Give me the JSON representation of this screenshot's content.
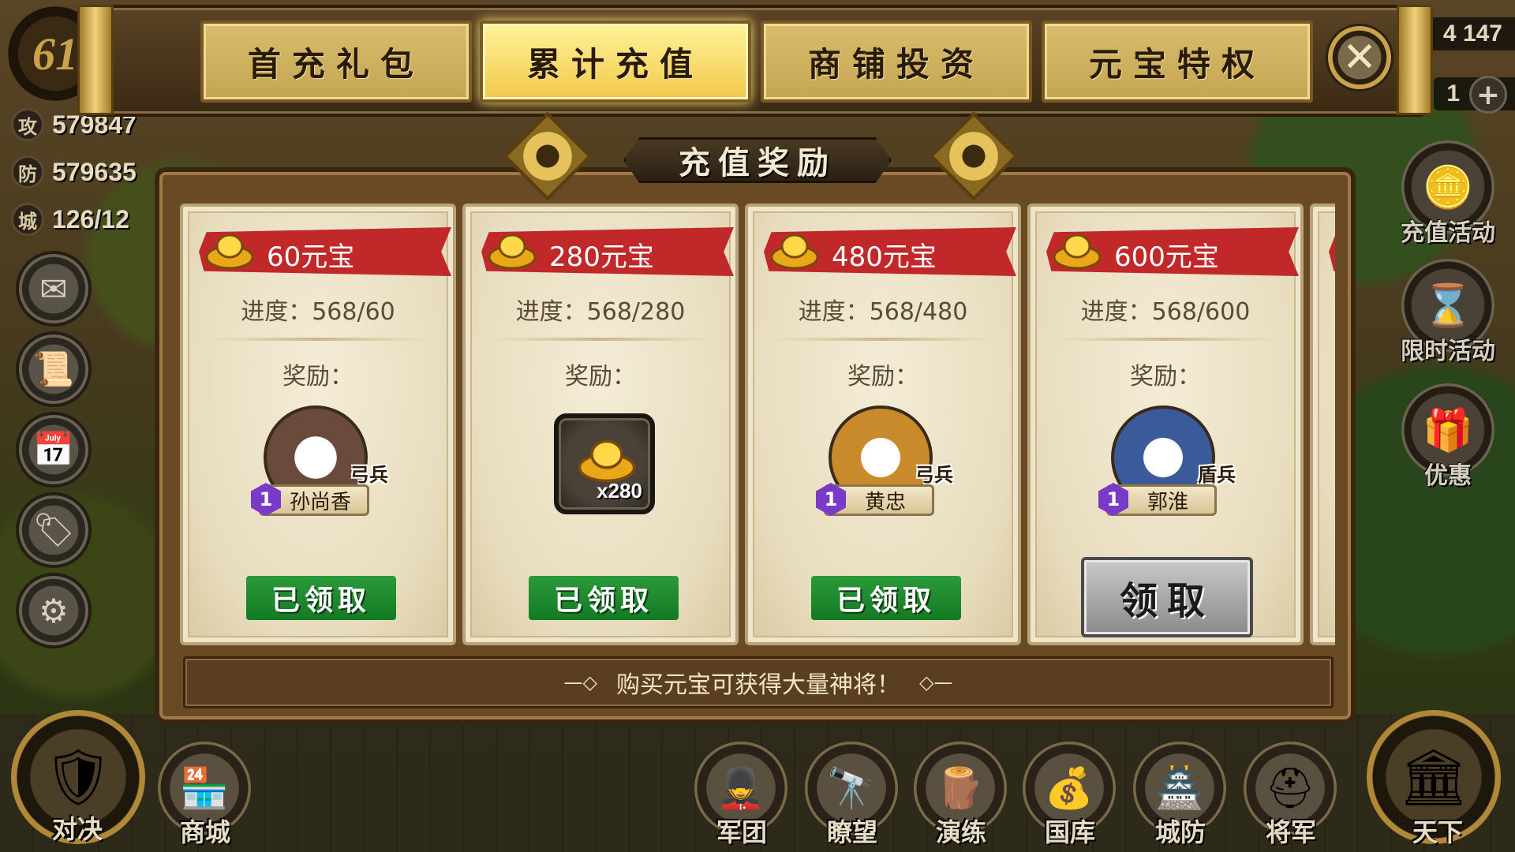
{
  "hud": {
    "level": "61",
    "stats": [
      {
        "icon": "攻",
        "value": "579847"
      },
      {
        "icon": "防",
        "value": "579635"
      },
      {
        "icon": "城",
        "value": "126/12"
      }
    ],
    "resources": [
      "4 147",
      "1"
    ]
  },
  "tabs": [
    {
      "label": "首充礼包",
      "active": false
    },
    {
      "label": "累计充值",
      "active": true
    },
    {
      "label": "商铺投资",
      "active": false
    },
    {
      "label": "元宝特权",
      "active": false
    }
  ],
  "panel": {
    "title": "充值奖励",
    "footer": "购买元宝可获得大量神将！"
  },
  "cards": [
    {
      "title": "60元宝",
      "progress": "进度：568/60",
      "reward_label": "奖励：",
      "reward": {
        "kind": "hero",
        "name": "孙尚香",
        "class": "弓兵",
        "star": "1"
      },
      "button": "已领取",
      "claimed": true
    },
    {
      "title": "280元宝",
      "progress": "进度：568/280",
      "reward_label": "奖励：",
      "reward": {
        "kind": "item",
        "count": "x280"
      },
      "button": "已领取",
      "claimed": true
    },
    {
      "title": "480元宝",
      "progress": "进度：568/480",
      "reward_label": "奖励：",
      "reward": {
        "kind": "hero",
        "name": "黄忠",
        "class": "弓兵",
        "star": "1"
      },
      "button": "已领取",
      "claimed": true
    },
    {
      "title": "600元宝",
      "progress": "进度：568/600",
      "reward_label": "奖励：",
      "reward": {
        "kind": "hero",
        "name": "郭淮",
        "class": "盾兵",
        "star": "1"
      },
      "button": "领取",
      "claimed": false
    }
  ],
  "right_menu": [
    "充值活动",
    "限时活动",
    "优惠"
  ],
  "bottom_menu": [
    "对决",
    "商城",
    "军团",
    "瞭望",
    "演练",
    "国库",
    "城防",
    "将军",
    "天下"
  ]
}
